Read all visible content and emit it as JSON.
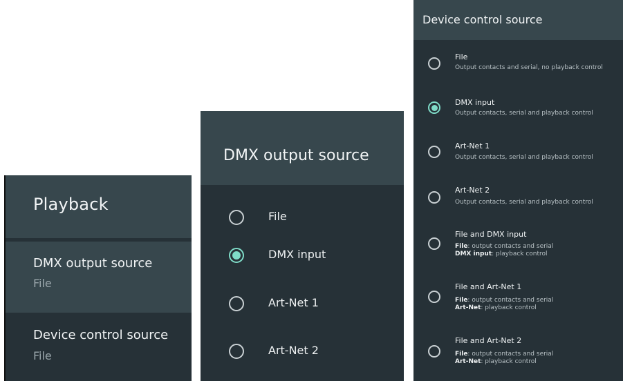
{
  "colors": {
    "panel_background": "#263137",
    "header_background": "#37474d",
    "accent": "#7fdcc8",
    "secondary_text": "#9aa6ab"
  },
  "playback": {
    "title": "Playback",
    "items": [
      {
        "title": "DMX output source",
        "value": "File",
        "selected": true
      },
      {
        "title": "Device control source",
        "value": "File",
        "selected": false
      }
    ]
  },
  "dmx_output": {
    "title": "DMX output source",
    "selected_index": 1,
    "options": [
      {
        "label": "File"
      },
      {
        "label": "DMX input"
      },
      {
        "label": "Art-Net 1"
      },
      {
        "label": "Art-Net 2"
      }
    ]
  },
  "device_control": {
    "title": "Device control source",
    "selected_index": 1,
    "options": [
      {
        "title": "File",
        "desc": "Output contacts and serial, no playback control"
      },
      {
        "title": "DMX input",
        "desc": "Output contacts, serial and playback control"
      },
      {
        "title": "Art-Net 1",
        "desc": "Output contacts, serial and playback control"
      },
      {
        "title": "Art-Net 2",
        "desc": "Output contacts, serial and playback control"
      },
      {
        "title": "File and DMX input",
        "line1_key": "File",
        "line1_text": ": output contacts and serial",
        "line2_key": "DMX input",
        "line2_text": ": playback control"
      },
      {
        "title": "File and Art-Net 1",
        "line1_key": "File",
        "line1_text": ": output contacts and serial",
        "line2_key": "Art-Net",
        "line2_text": ": playback control"
      },
      {
        "title": "File and Art-Net 2",
        "line1_key": "File",
        "line1_text": ": output contacts and serial",
        "line2_key": "Art-Net",
        "line2_text": ": playback control"
      }
    ]
  }
}
